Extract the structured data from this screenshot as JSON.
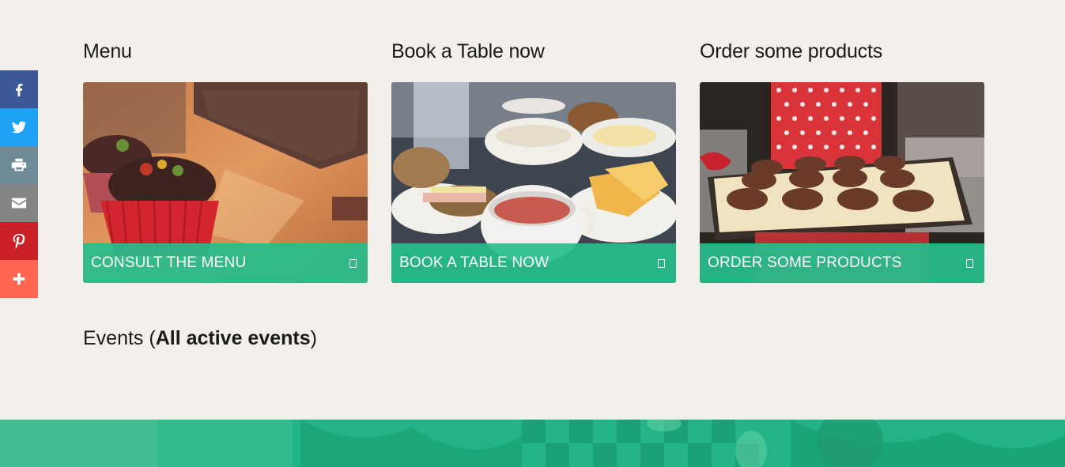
{
  "share": {
    "items": [
      {
        "name": "facebook",
        "color": "#3b5998",
        "icon": "facebook-icon"
      },
      {
        "name": "twitter",
        "color": "#1da1f2",
        "icon": "twitter-icon"
      },
      {
        "name": "print",
        "color": "#6d8a96",
        "icon": "print-icon"
      },
      {
        "name": "email",
        "color": "#848484",
        "icon": "email-icon"
      },
      {
        "name": "pinterest",
        "color": "#cb2027",
        "icon": "pinterest-icon"
      },
      {
        "name": "more",
        "color": "#ff6550",
        "icon": "plus-icon"
      }
    ]
  },
  "cards": [
    {
      "title": "Menu",
      "label": "CONSULT THE MENU",
      "image": "cupcakes-photo"
    },
    {
      "title": "Book a Table now",
      "label": "BOOK A TABLE NOW",
      "image": "breakfast-table-photo"
    },
    {
      "title": "Order some products",
      "label": "ORDER SOME PRODUCTS",
      "image": "muffin-tray-photo"
    }
  ],
  "events": {
    "prefix": "Events (",
    "bold": "All active events",
    "suffix": ")"
  },
  "colors": {
    "background": "#f3f0eb",
    "accent": "#26be8c"
  }
}
